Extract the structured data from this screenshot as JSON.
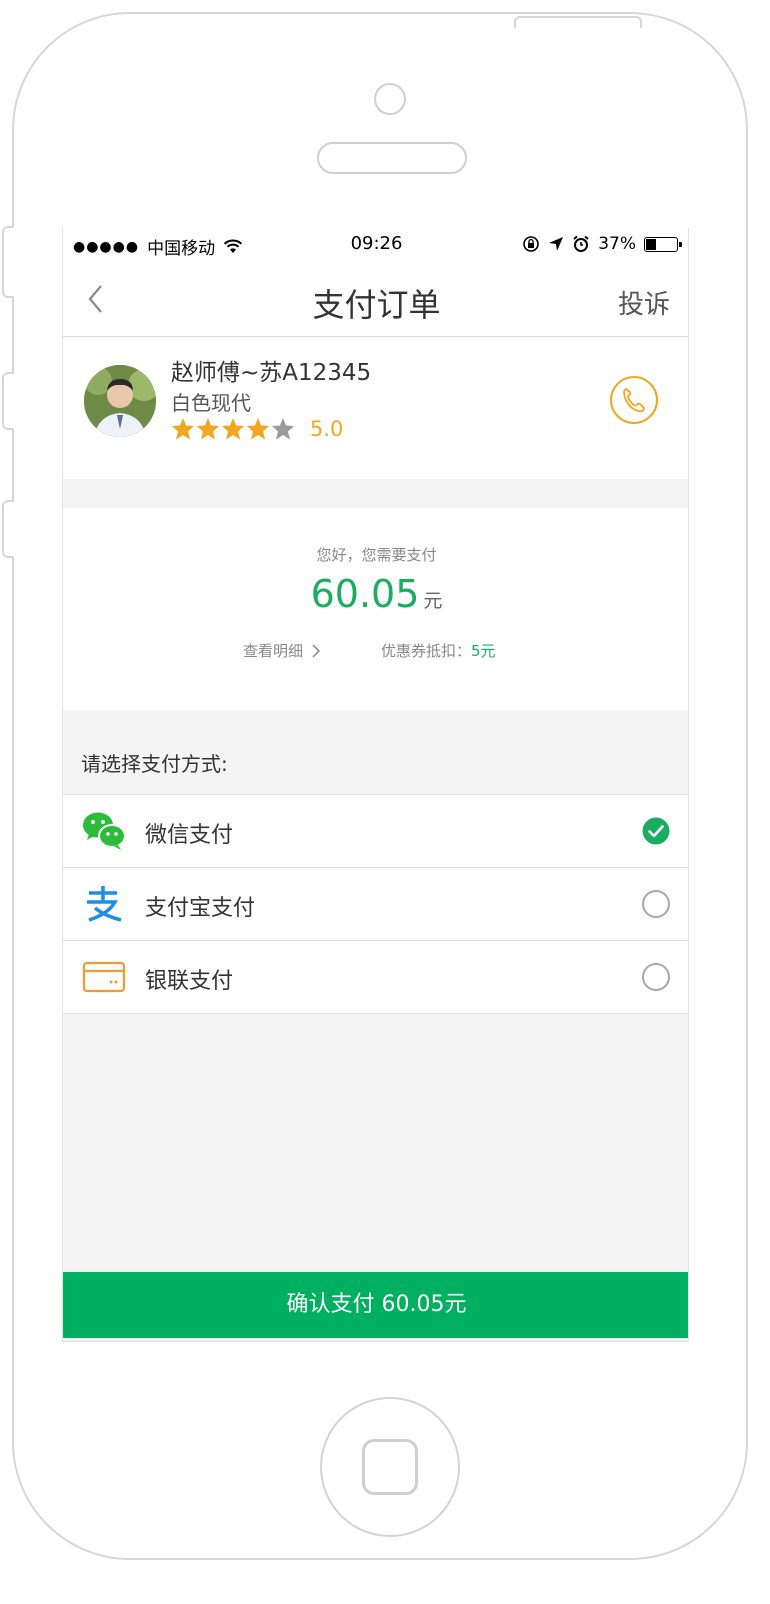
{
  "status_bar": {
    "signal": "●●●●●",
    "carrier": "中国移动",
    "time": "09:26",
    "battery": "37%",
    "battery_level": 0.37
  },
  "nav": {
    "title": "支付订单",
    "right": "投诉",
    "back_icon": "chevron-left-icon"
  },
  "driver": {
    "name": "赵师傅~苏A12345",
    "car": "白色现代",
    "rating_stars": 4,
    "rating": "5.0",
    "call_icon": "phone-icon"
  },
  "summary": {
    "greeting": "您好，您需要支付",
    "amount": "60.05",
    "unit": "元",
    "detail_link": "查看明细",
    "coupon_label": "优惠券抵扣：",
    "coupon_value": "5元"
  },
  "payment": {
    "prompt": "请选择支付方式:",
    "methods": [
      {
        "label": "微信支付",
        "icon": "wechat-icon",
        "selected": true
      },
      {
        "label": "支付宝支付",
        "icon": "alipay-icon",
        "selected": false
      },
      {
        "label": "银联支付",
        "icon": "unionpay-card-icon",
        "selected": false
      }
    ]
  },
  "confirm": {
    "label": "确认支付 60.05元"
  },
  "colors": {
    "primary_green": "#00b060",
    "amount_green": "#1aad5f",
    "accent_orange": "#f0a61e",
    "alipay_blue": "#1b8fe6",
    "card_orange": "#f39a2c"
  }
}
